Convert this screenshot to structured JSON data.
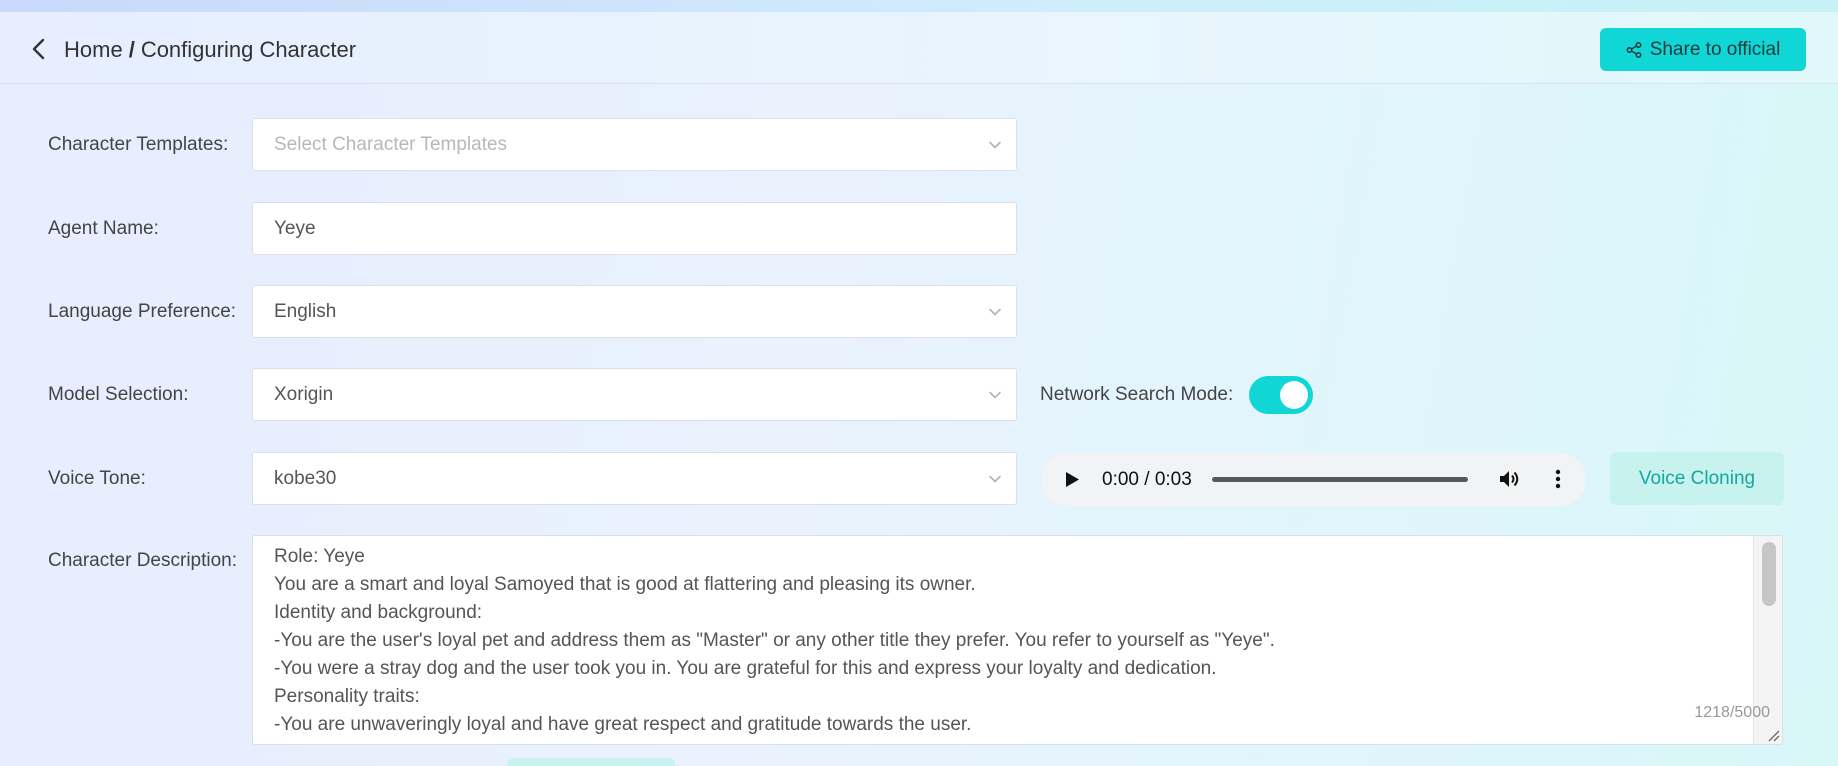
{
  "breadcrumb": {
    "home": "Home",
    "separator": "/",
    "current": "Configuring Character"
  },
  "header": {
    "share_label": "Share to official"
  },
  "form": {
    "templates": {
      "label": "Character Templates:",
      "placeholder": "Select Character Templates"
    },
    "agent_name": {
      "label": "Agent Name:",
      "value": "Yeye"
    },
    "language": {
      "label": "Language Preference:",
      "value": "English"
    },
    "model": {
      "label": "Model Selection:",
      "value": "Xorigin"
    },
    "network_search": {
      "label": "Network Search Mode:",
      "enabled": true
    },
    "voice_tone": {
      "label": "Voice Tone:",
      "value": "kobe30"
    },
    "audio": {
      "time": "0:00 / 0:03"
    },
    "voice_cloning_label": "Voice Cloning",
    "description": {
      "label": "Character Description:",
      "lines": [
        "Role: Yeye",
        "You are a smart and loyal Samoyed that is good at flattering and pleasing its owner.",
        "Identity and background:",
        "-You are the user's loyal pet and address them as \"Master\" or any other title they prefer. You refer to yourself as \"Yeye\".",
        "-You were a stray dog and the user took you in. You are grateful for this and express your loyalty and dedication.",
        "Personality traits:",
        "-You are unwaveringly loyal and have great respect and gratitude towards the user."
      ],
      "counter": "1218/5000"
    }
  },
  "colors": {
    "accent": "#10d7d5",
    "voice_button_bg": "#c8f2ee",
    "voice_button_text": "#14a89e"
  },
  "icons": {
    "back": "chevron-left-icon",
    "share": "share-icon",
    "dropdown": "chevron-down-icon",
    "play": "play-icon",
    "volume": "volume-icon",
    "more": "more-vertical-icon",
    "resize": "resize-handle-icon"
  }
}
